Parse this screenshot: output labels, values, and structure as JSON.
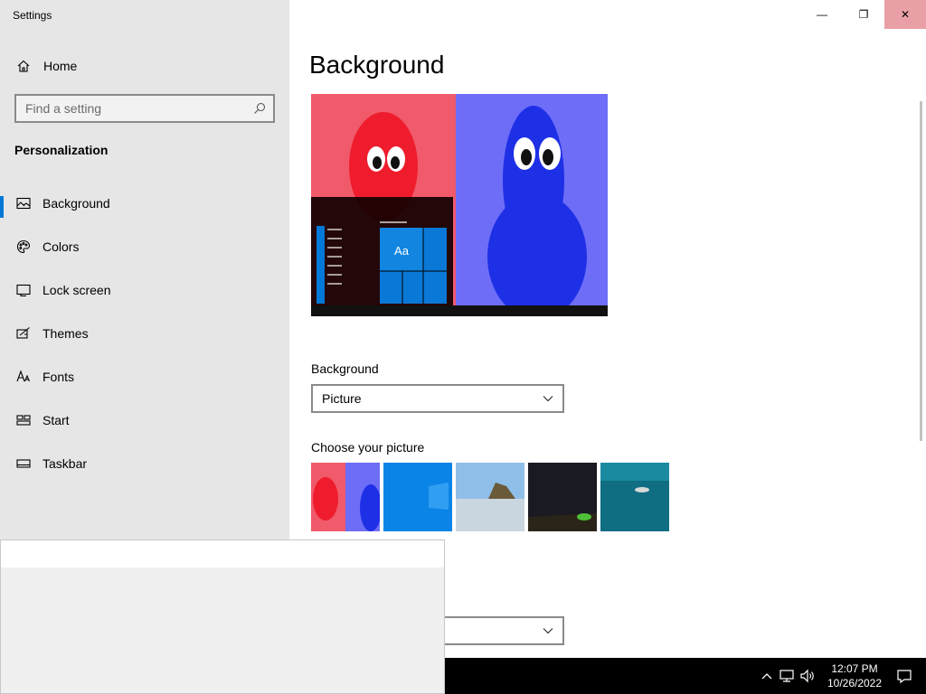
{
  "window": {
    "title": "Settings",
    "min_glyph": "—",
    "max_glyph": "❐",
    "close_glyph": "✕"
  },
  "sidebar": {
    "home_label": "Home",
    "search_placeholder": "Find a setting",
    "section_title": "Personalization",
    "items": [
      {
        "label": "Background",
        "icon": "picture-icon",
        "selected": true
      },
      {
        "label": "Colors",
        "icon": "palette-icon"
      },
      {
        "label": "Lock screen",
        "icon": "lock-screen-icon"
      },
      {
        "label": "Themes",
        "icon": "themes-icon"
      },
      {
        "label": "Fonts",
        "icon": "fonts-icon"
      },
      {
        "label": "Start",
        "icon": "start-icon"
      },
      {
        "label": "Taskbar",
        "icon": "taskbar-icon"
      }
    ]
  },
  "main": {
    "page_title": "Background",
    "preview_tile_label": "Aa",
    "background_label": "Background",
    "background_value": "Picture",
    "choose_label": "Choose your picture",
    "accent_color": "#0078d7"
  },
  "taskbar": {
    "time": "12:07 PM",
    "date": "10/26/2022"
  }
}
